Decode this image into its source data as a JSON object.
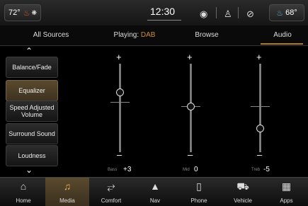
{
  "status": {
    "left_temp": "72°",
    "right_temp": "68°",
    "time": "12:30",
    "icons": [
      "seat-heat-icon",
      "fan-icon",
      "settings-icon",
      "user-icon",
      "no-wifi-icon",
      "seat-heat-right-icon"
    ]
  },
  "tabs": [
    {
      "label": "All Sources"
    },
    {
      "label": "Playing:",
      "source": "DAB"
    },
    {
      "label": "Browse"
    },
    {
      "label": "Audio"
    }
  ],
  "menu": {
    "items": [
      {
        "label": "Balance/Fade"
      },
      {
        "label": "Equalizer"
      },
      {
        "label": "Speed Adjusted Volume"
      },
      {
        "label": "Surround Sound"
      },
      {
        "label": "Loudness"
      }
    ]
  },
  "equalizer": {
    "bands": [
      {
        "label": "Bass",
        "value": "+3"
      },
      {
        "label": "Mid",
        "value": "0"
      },
      {
        "label": "Treb",
        "value": "-5"
      }
    ]
  },
  "nav": {
    "items": [
      {
        "label": "Home",
        "icon": "home-icon"
      },
      {
        "label": "Media",
        "icon": "music-note-icon"
      },
      {
        "label": "Comfort",
        "icon": "seat-icon"
      },
      {
        "label": "Nav",
        "icon": "navigation-arrow-icon"
      },
      {
        "label": "Phone",
        "icon": "phone-icon"
      },
      {
        "label": "Vehicle",
        "icon": "car-icon"
      },
      {
        "label": "Apps",
        "icon": "grid-icon"
      }
    ]
  },
  "colors": {
    "accent": "#b07a2a",
    "dab": "#d08a3a",
    "active_bg": "#4a3d27"
  }
}
